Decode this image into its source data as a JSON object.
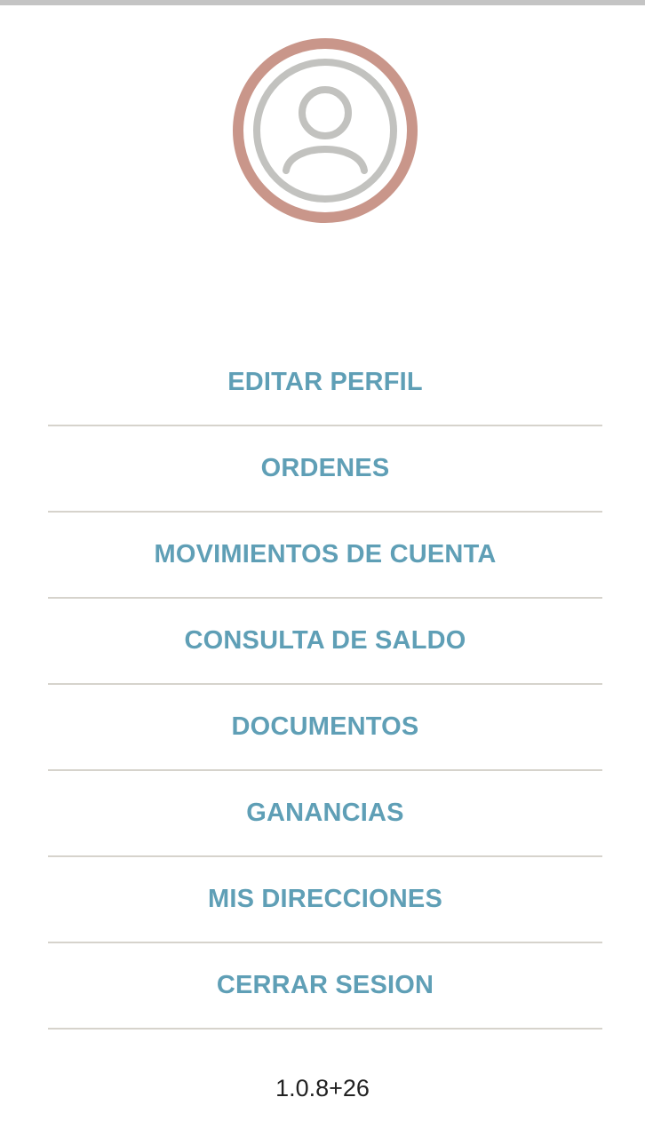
{
  "colors": {
    "accent_text": "#5f9fb6",
    "avatar_ring": "#c9968a",
    "avatar_icon": "#c2c2bf",
    "divider": "#d6d3cc"
  },
  "avatar": {
    "icon": "user-icon"
  },
  "menu": {
    "items": [
      {
        "label": "EDITAR PERFIL"
      },
      {
        "label": "ORDENES"
      },
      {
        "label": "MOVIMIENTOS DE CUENTA"
      },
      {
        "label": "CONSULTA DE SALDO"
      },
      {
        "label": "DOCUMENTOS"
      },
      {
        "label": "GANANCIAS"
      },
      {
        "label": "MIS DIRECCIONES"
      },
      {
        "label": "CERRAR SESION"
      }
    ]
  },
  "footer": {
    "version": "1.0.8+26"
  }
}
